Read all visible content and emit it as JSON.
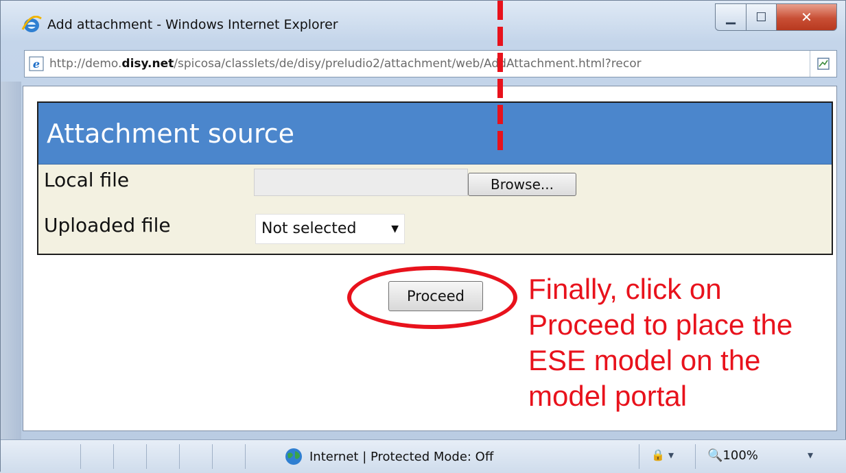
{
  "window": {
    "title": "Add attachment - Windows Internet Explorer",
    "minimize_glyph": "▁",
    "maximize_glyph": "☐",
    "close_glyph": "✕",
    "icon": "internet-explorer-icon"
  },
  "address_bar": {
    "url_prefix": "http://demo.",
    "url_domain": "disy.net",
    "url_suffix": "/spicosa/classlets/de/disy/preludio2/attachment/web/AddAttachment.html?recor",
    "compat_icon": "compatibility-view-icon"
  },
  "form": {
    "header": "Attachment source",
    "local_file_label": "Local file",
    "local_file_value": "",
    "browse_label": "Browse...",
    "uploaded_file_label": "Uploaded file",
    "uploaded_file_selected": "Not selected",
    "proceed_label": "Proceed"
  },
  "annotation": {
    "callout_text": "Finally,  click on\nProceed to place the\nESE model on the\nmodel portal",
    "color": "#e8121c"
  },
  "status_bar": {
    "zone_text": "Internet | Protected Mode: Off",
    "zoom": "100%",
    "zone_icon": "globe-icon"
  }
}
